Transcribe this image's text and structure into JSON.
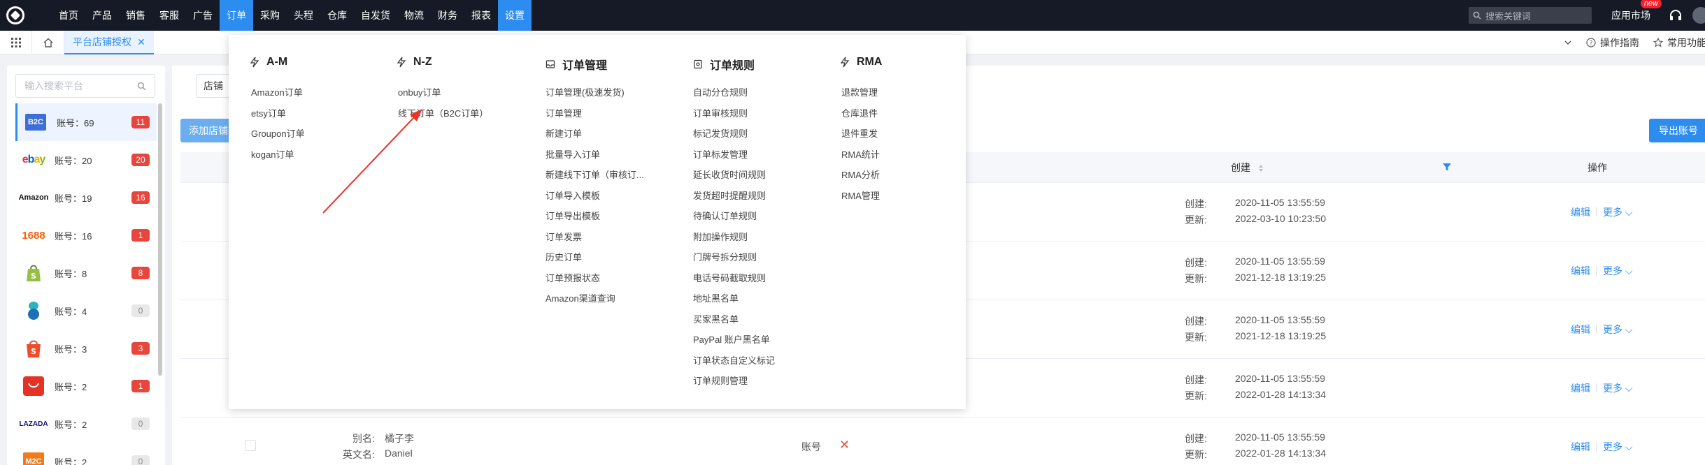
{
  "topbar": {
    "nav": [
      "首页",
      "产品",
      "销售",
      "客服",
      "广告",
      "订单",
      "采购",
      "头程",
      "仓库",
      "自发货",
      "物流",
      "财务",
      "报表",
      "设置"
    ],
    "active_nav": "订单",
    "search_placeholder": "搜索关键词",
    "app_market": "应用市场",
    "new_badge": "new"
  },
  "tabbar": {
    "active_tab": "平台店铺授权",
    "guide": "操作指南",
    "common": "常用功能"
  },
  "sidebar": {
    "search_placeholder": "输入搜索平台",
    "platforms": [
      {
        "name": "B2C",
        "label": "账号：69",
        "badge": "11"
      },
      {
        "name": "ebay",
        "label": "账号：20",
        "badge": "20"
      },
      {
        "name": "Amazon",
        "label": "账号：19",
        "badge": "16"
      },
      {
        "name": "1688",
        "label": "账号：16",
        "badge": "1"
      },
      {
        "name": "Shopify",
        "label": "账号：8",
        "badge": "8"
      },
      {
        "name": "Platform6",
        "label": "账号：4",
        "badge": "0"
      },
      {
        "name": "Shopee",
        "label": "账号：3",
        "badge": "3"
      },
      {
        "name": "AliExpress",
        "label": "账号：2",
        "badge": "1"
      },
      {
        "name": "LAZADA",
        "label": "账号：2",
        "badge": "0"
      },
      {
        "name": "M2C",
        "label": "账号：2",
        "badge": "0"
      }
    ]
  },
  "main": {
    "store_select": "店铺",
    "add_button": "添加店铺",
    "export_button": "导出账号",
    "col_created": "创建",
    "col_operation": "操作",
    "rows": [
      {
        "created_label": "创建:",
        "created": "2020-11-05 13:55:59",
        "updated_label": "更新:",
        "updated": "2022-03-10 10:23:50",
        "edit": "编辑",
        "more": "更多"
      },
      {
        "created_label": "创建:",
        "created": "2020-11-05 13:55:59",
        "updated_label": "更新:",
        "updated": "2021-12-18 13:19:25",
        "edit": "编辑",
        "more": "更多"
      },
      {
        "created_label": "创建:",
        "created": "2020-11-05 13:55:59",
        "updated_label": "更新:",
        "updated": "2021-12-18 13:19:25",
        "edit": "编辑",
        "more": "更多"
      },
      {
        "created_label": "创建:",
        "created": "2020-11-05 13:55:59",
        "updated_label": "更新:",
        "updated": "2022-01-28 14:13:34",
        "edit": "编辑",
        "more": "更多"
      },
      {
        "created_label": "创建:",
        "created": "2020-11-05 13:55:59",
        "updated_label": "更新:",
        "updated": "2022-01-28 14:13:34",
        "edit": "编辑",
        "more": "更多",
        "alias_label": "别名:",
        "alias": "橘子李",
        "en_label": "英文名:",
        "en": "Daniel",
        "acct": "账号"
      }
    ]
  },
  "dropdown": {
    "columns": [
      {
        "title": "A-M",
        "items": [
          "Amazon订单",
          "etsy订单",
          "Groupon订单",
          "kogan订单"
        ]
      },
      {
        "title": "N-Z",
        "items": [
          "onbuy订单",
          "线下订单（B2C订单）"
        ]
      },
      {
        "title": "订单管理",
        "items": [
          "订单管理(极速发货)",
          "订单管理",
          "新建订单",
          "批量导入订单",
          "新建线下订单（审核订...",
          "订单导入模板",
          "订单导出模板",
          "订单发票",
          "历史订单",
          "订单预报状态",
          "Amazon渠道查询"
        ]
      },
      {
        "title": "订单规则",
        "items": [
          "自动分仓规则",
          "订单审核规则",
          "标记发货规则",
          "订单标发管理",
          "延长收货时间规则",
          "发货超时提醒规则",
          "待确认订单规则",
          "附加操作规则",
          "门牌号拆分规则",
          "电话号码截取规则",
          "地址黑名单",
          "买家黑名单",
          "PayPal 账户黑名单",
          "订单状态自定义标记",
          "订单规则管理"
        ]
      },
      {
        "title": "RMA",
        "items": [
          "退款管理",
          "仓库退件",
          "退件重发",
          "RMA统计",
          "RMA分析",
          "RMA管理"
        ]
      }
    ]
  },
  "colors": {
    "accent": "#2d8cf0",
    "topbar": "#151a26",
    "arrow": "#e8352b"
  }
}
